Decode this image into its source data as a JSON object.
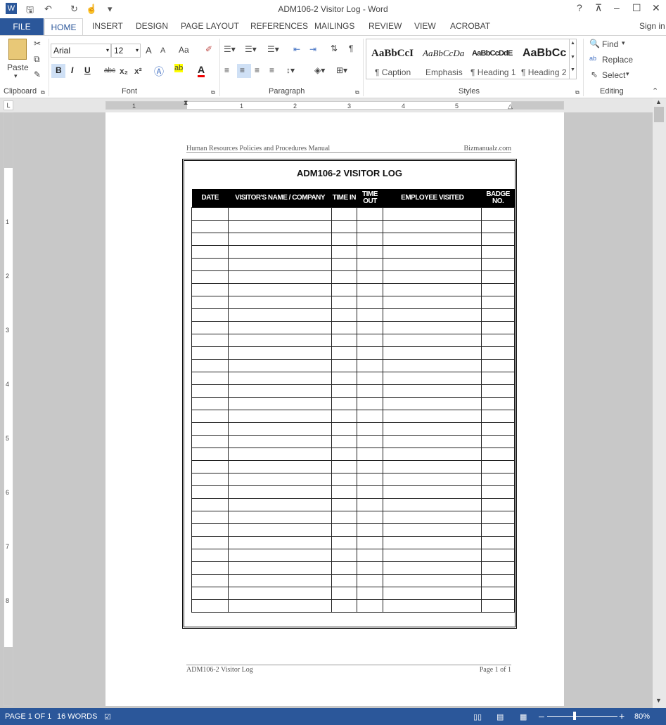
{
  "titlebar": {
    "title": "ADM106-2 Visitor Log - Word",
    "help": "?",
    "restore_ribbon": "⊼",
    "minimize": "–",
    "maximize": "☐",
    "close": "✕"
  },
  "tabs": {
    "file": "FILE",
    "home": "HOME",
    "insert": "INSERT",
    "design": "DESIGN",
    "page_layout": "PAGE LAYOUT",
    "references": "REFERENCES",
    "mailings": "MAILINGS",
    "review": "REVIEW",
    "view": "VIEW",
    "acrobat": "ACROBAT",
    "sign_in": "Sign in"
  },
  "ribbon": {
    "clipboard": {
      "label": "Clipboard",
      "paste": "Paste"
    },
    "font": {
      "label": "Font",
      "family": "Arial",
      "size": "12",
      "change_case": "Aa",
      "bold": "B",
      "italic": "I",
      "underline": "U",
      "strikethrough": "abc",
      "subscript": "x₂",
      "superscript": "x²",
      "grow": "A",
      "shrink": "A"
    },
    "paragraph": {
      "label": "Paragraph",
      "pilcrow": "¶"
    },
    "styles": {
      "label": "Styles",
      "items": [
        {
          "preview": "AaBbCcI",
          "name": "¶ Caption"
        },
        {
          "preview": "AaBbCcDa",
          "name": "Emphasis"
        },
        {
          "preview": "AaBbCcDdE",
          "name": "¶ Heading 1"
        },
        {
          "preview": "AaBbCc",
          "name": "¶ Heading 2"
        }
      ]
    },
    "editing": {
      "label": "Editing",
      "find": "Find",
      "replace": "Replace",
      "select": "Select"
    }
  },
  "ruler": {
    "numbers": [
      "1",
      "1",
      "2",
      "3",
      "4",
      "5"
    ]
  },
  "vruler": {
    "numbers": [
      "1",
      "2",
      "3",
      "4",
      "5",
      "6",
      "7",
      "8"
    ]
  },
  "document": {
    "header_left": "Human Resources Policies and Procedures Manual",
    "header_right": "Bizmanualz.com",
    "title": "ADM106-2 VISITOR LOG",
    "columns": [
      "DATE",
      "VISITOR'S NAME / COMPANY",
      "TIME IN",
      "TIME OUT",
      "EMPLOYEE VISITED",
      "BADGE NO."
    ],
    "empty_rows": 32,
    "footer_left": "ADM106-2 Visitor Log",
    "footer_right": "Page 1 of 1"
  },
  "statusbar": {
    "page": "PAGE 1 OF 1",
    "words": "16 WORDS",
    "zoom": "80%"
  },
  "colors": {
    "accent": "#2b579a",
    "table_header": "#000000"
  }
}
